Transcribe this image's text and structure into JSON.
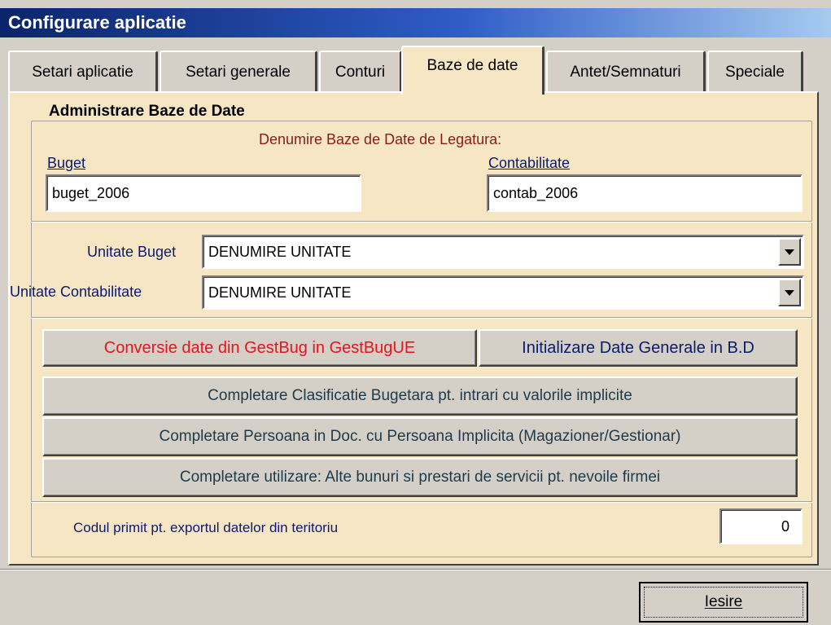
{
  "window": {
    "title": "Configurare aplicatie"
  },
  "tabs": [
    {
      "label": "Setari aplicatie"
    },
    {
      "label": "Setari generale"
    },
    {
      "label": "Conturi"
    },
    {
      "label": "Baze de date",
      "active": true
    },
    {
      "label": "Antet/Semnaturi"
    },
    {
      "label": "Speciale"
    }
  ],
  "group": {
    "title": "Administrare Baze de Date",
    "subtitle": "Denumire Baze de Date de Legatura:",
    "buget_label": "Buget",
    "buget_value": "buget_2006",
    "contab_label": "Contabilitate",
    "contab_value": "contab_2006",
    "unitate_buget_label": "Unitate Buget",
    "unitate_buget_value": "DENUMIRE UNITATE",
    "unitate_contab_label": "Unitate Contabilitate",
    "unitate_contab_value": "DENUMIRE UNITATE",
    "btn_conversie": "Conversie date din GestBug in GestBugUE",
    "btn_initializare": "Initializare Date Generale in B.D",
    "btn_clasificatie": "Completare Clasificatie Bugetara pt. intrari cu valorile implicite",
    "btn_persoana": "Completare Persoana in Doc. cu Persoana Implicita (Magazioner/Gestionar)",
    "btn_utilizare": "Completare utilizare: Alte bunuri si prestari de servicii pt. nevoile firmei",
    "cod_label": "Codul primit pt. exportul datelor din teritoriu",
    "cod_value": "0"
  },
  "footer": {
    "exit_label": "Iesire"
  },
  "colors": {
    "title_gradient_start": "#0a246a",
    "panel_bg": "#f7e6c3",
    "red_text": "#e8141c",
    "navy_text": "#0a1a6e"
  }
}
